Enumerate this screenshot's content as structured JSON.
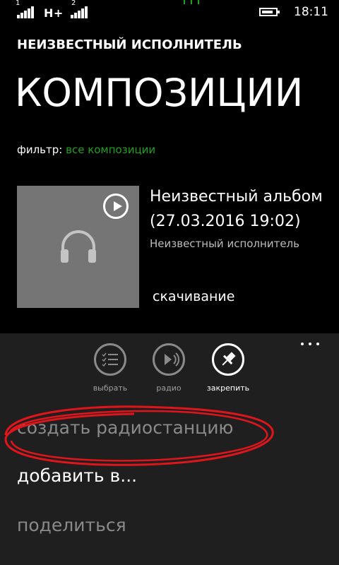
{
  "status_bar": {
    "sim1_label": "1",
    "network_type": "H+",
    "sim2_label": "2",
    "time": "18:11"
  },
  "header": {
    "app_title": "НЕИЗВЕСТНЫЙ ИСПОЛНИТЕЛЬ",
    "page_title": "КОМПОЗИЦИИ"
  },
  "filter": {
    "label": "фильтр:",
    "value": "все композиции"
  },
  "album": {
    "name": "Неизвестный альбом",
    "date": "(27.03.2016 19:02)",
    "artist": "Неизвестный исполнитель",
    "status": "скачивание"
  },
  "app_bar": {
    "buttons": [
      {
        "label": "выбрать",
        "icon": "list-select-icon"
      },
      {
        "label": "радио",
        "icon": "radio-icon"
      },
      {
        "label": "закрепить",
        "icon": "pin-icon"
      }
    ],
    "menu_items": [
      {
        "label": "создать радиостанцию"
      },
      {
        "label": "добавить в..."
      },
      {
        "label": "поделиться"
      }
    ]
  },
  "colors": {
    "accent": "#1ca11c",
    "annotation": "#e0151b",
    "tile": "#757575",
    "app_bar_bg": "#1f1f1f"
  }
}
